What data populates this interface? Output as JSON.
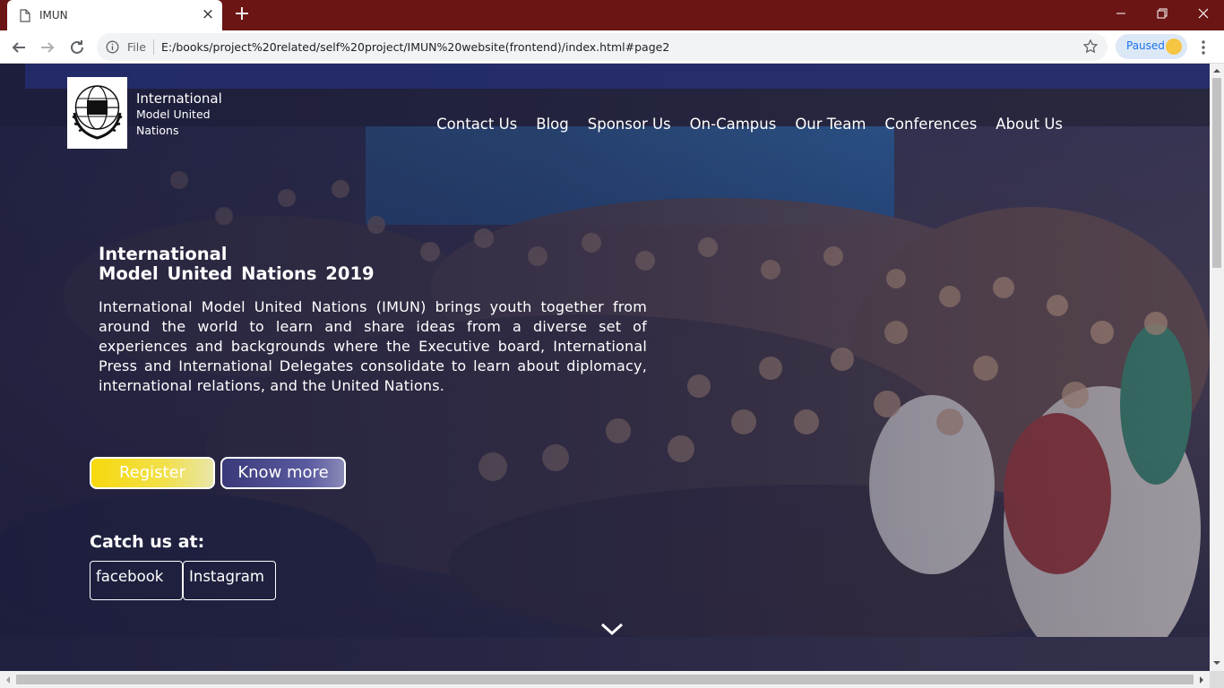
{
  "browser": {
    "tab_title": "IMUN",
    "file_label": "File",
    "url": "E:/books/project%20related/self%20project/IMUN%20website(frontend)/index.html#page2",
    "profile_status": "Paused"
  },
  "header": {
    "brand_line1": "International",
    "brand_line2": "Model United",
    "brand_line3": "Nations",
    "nav": [
      {
        "label": "Contact Us"
      },
      {
        "label": "Blog"
      },
      {
        "label": "Sponsor Us"
      },
      {
        "label": "On-Campus"
      },
      {
        "label": "Our Team"
      },
      {
        "label": "Conferences"
      },
      {
        "label": "About Us"
      }
    ]
  },
  "hero": {
    "title_line1": "International",
    "title_line2": "Model United Nations 2019",
    "description": "International Model United Nations (IMUN) brings youth together from around the world to learn and share ideas from a diverse set of experiences and backgrounds where the Executive board, International Press and International Delegates consolidate to learn about diplomacy, international relations, and the United Nations.",
    "register_label": "Register",
    "know_more_label": "Know more"
  },
  "social": {
    "title": "Catch us at:",
    "facebook_label": "facebook",
    "instagram_label": "Instagram"
  },
  "icons": {
    "logo": "imun-globe-logo",
    "scroll": "chevron-down-icon"
  },
  "colors": {
    "titlebar": "#6b1515",
    "register": "#f7d90e",
    "know_more": "#3a3a7a"
  }
}
